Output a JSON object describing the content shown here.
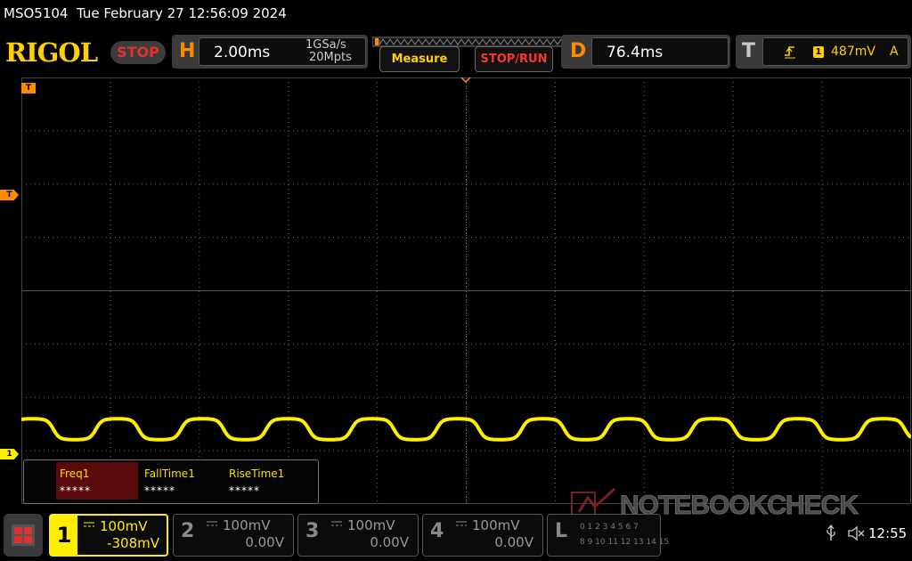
{
  "status_bar": {
    "text": "MSO5104  Tue February 27 12:56:09 2024"
  },
  "brand": {
    "logo": "RIGOL",
    "run_state": "STOP",
    "run_state_color": "#e03030"
  },
  "horizontal": {
    "label": "H",
    "timebase": "2.00ms",
    "sample_rate": "1GSa/s",
    "memory_depth": "20Mpts"
  },
  "buttons": {
    "measure": "Measure",
    "stop_run": "STOP/RUN"
  },
  "delay": {
    "label": "D",
    "value": "76.4ms"
  },
  "trigger": {
    "label": "T",
    "source": "1",
    "level": "487mV",
    "mode": "A"
  },
  "markers": {
    "trigger_marker": "T",
    "channel1_marker": "1"
  },
  "measurements": [
    {
      "label": "Freq1",
      "value": "*****",
      "selected": true
    },
    {
      "label": "FallTime1",
      "value": "*****",
      "selected": false
    },
    {
      "label": "RiseTime1",
      "value": "*****",
      "selected": false
    }
  ],
  "channels": [
    {
      "number": "1",
      "scale": "100mV",
      "offset": "-308mV",
      "active": true,
      "color": "#ffee00"
    },
    {
      "number": "2",
      "scale": "100mV",
      "offset": "0.00V",
      "active": false
    },
    {
      "number": "3",
      "scale": "100mV",
      "offset": "0.00V",
      "active": false
    },
    {
      "number": "4",
      "scale": "100mV",
      "offset": "0.00V",
      "active": false
    }
  ],
  "logic": {
    "label": "L",
    "row1": "0 1 2 3 4 5 6 7",
    "row2": "8 9 10 11 12 13 14 15"
  },
  "watermark": "NOTEBOOKCHECK",
  "system": {
    "time": "12:55"
  },
  "colors": {
    "trace": "#ffee00",
    "accent": "#ff8a00",
    "grid": "#6a6a6a"
  }
}
